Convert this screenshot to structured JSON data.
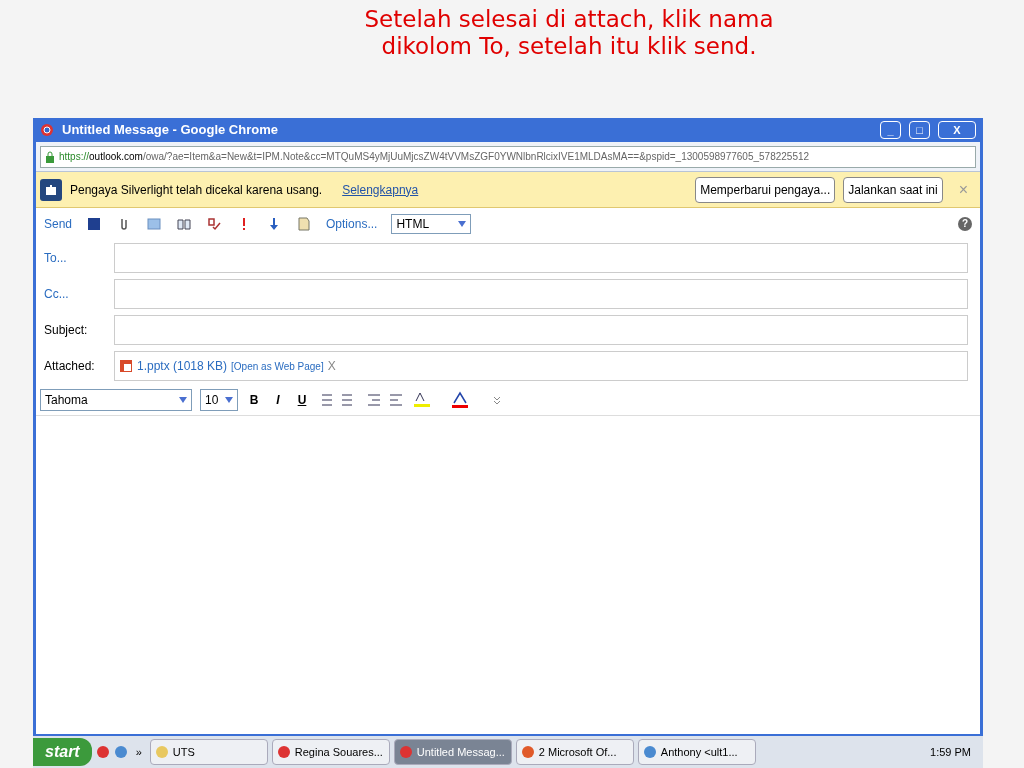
{
  "slide": {
    "instruction": "Setelah selesai di attach, klik nama dikolom To, setelah itu klik send."
  },
  "window": {
    "title": "Untitled Message - Google Chrome",
    "controls": [
      "_",
      "□",
      "X"
    ]
  },
  "address_bar": {
    "scheme": "https://",
    "host": "outlook.com",
    "path": "/owa/?ae=Item&a=New&t=IPM.Note&cc=MTQuMS4yMjUuMjcsZW4tVVMsZGF0YWNlbnRlcixIVE1MLDAsMA==&pspid=_1300598977605_578225512"
  },
  "infobar": {
    "message": "Pengaya Silverlight telah dicekal karena usang.",
    "link": "Selengkapnya",
    "buttons": [
      "Memperbarui pengaya...",
      "Jalankan saat ini"
    ],
    "close": "×"
  },
  "toolbar": {
    "send": "Send",
    "options": "Options...",
    "format": "HTML",
    "help": "?"
  },
  "fields": [
    {
      "label": "To...",
      "kind": "link"
    },
    {
      "label": "Cc...",
      "kind": "link"
    },
    {
      "label": "Subject:",
      "kind": "plain"
    }
  ],
  "attachment": {
    "label": "Attached:",
    "file": "1.pptx (1018 KB)",
    "action": "[Open as Web Page]",
    "remove": "X"
  },
  "format_bar": {
    "font": "Tahoma",
    "size": "10",
    "buttons": [
      "B",
      "I",
      "U"
    ]
  },
  "taskbar": {
    "start": "start",
    "more": "»",
    "items": [
      {
        "label": "UTS",
        "selected": false
      },
      {
        "label": "Regina Souares...",
        "selected": false
      },
      {
        "label": "Untitled Messag...",
        "selected": true
      },
      {
        "label": "2 Microsoft Of...",
        "selected": false
      },
      {
        "label": "Anthony <ult1...",
        "selected": false
      }
    ],
    "clock": "1:59 PM"
  }
}
